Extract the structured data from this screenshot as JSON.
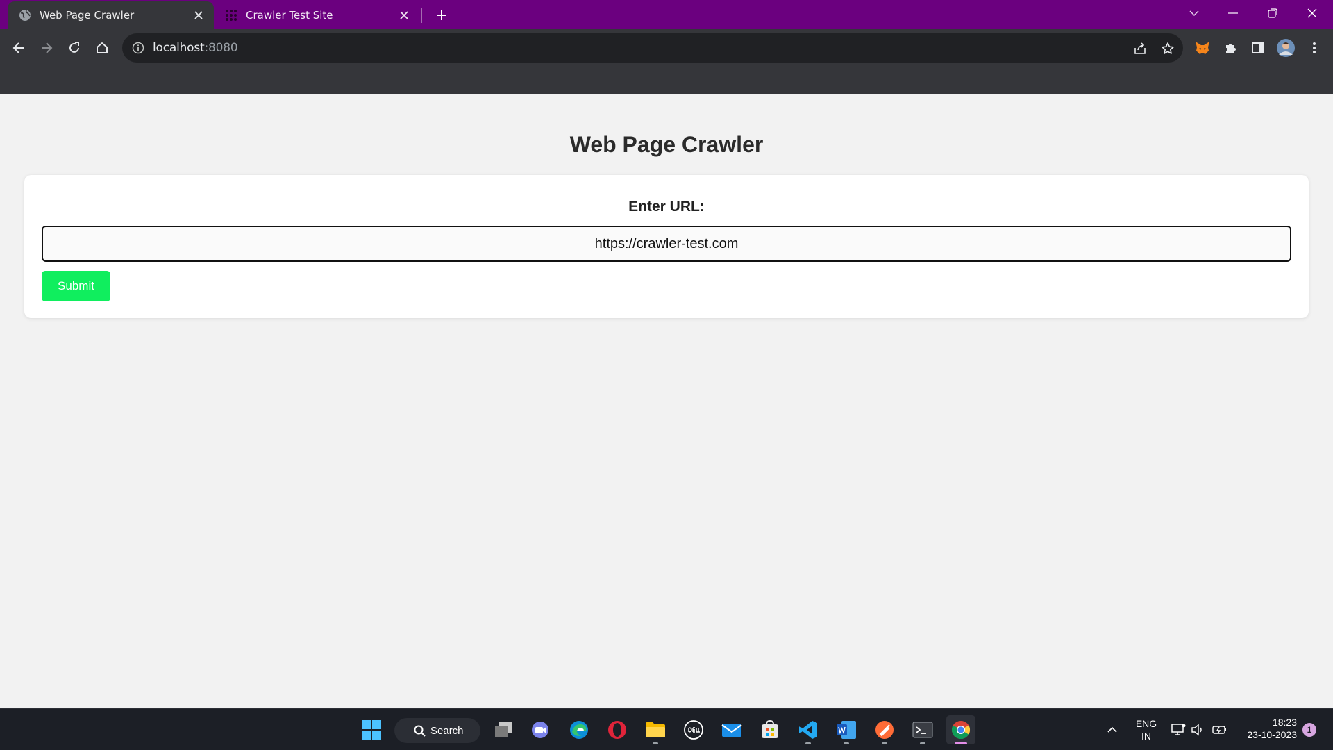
{
  "browser": {
    "tabs": [
      {
        "title": "Web Page Crawler",
        "active": true
      },
      {
        "title": "Crawler Test Site",
        "active": false
      }
    ],
    "address": {
      "host": "localhost",
      "port": ":8080"
    }
  },
  "page": {
    "title": "Web Page Crawler",
    "url_label": "Enter URL:",
    "url_value": "https://crawler-test.com",
    "submit_label": "Submit"
  },
  "taskbar": {
    "search_label": "Search",
    "language": {
      "line1": "ENG",
      "line2": "IN"
    },
    "time": "18:23",
    "date": "23-10-2023",
    "notification_count": "1"
  },
  "colors": {
    "titlebar": "#6b007f",
    "toolbar": "#35363a",
    "submit": "#10ee5e",
    "page_bg": "#f2f2f2"
  }
}
